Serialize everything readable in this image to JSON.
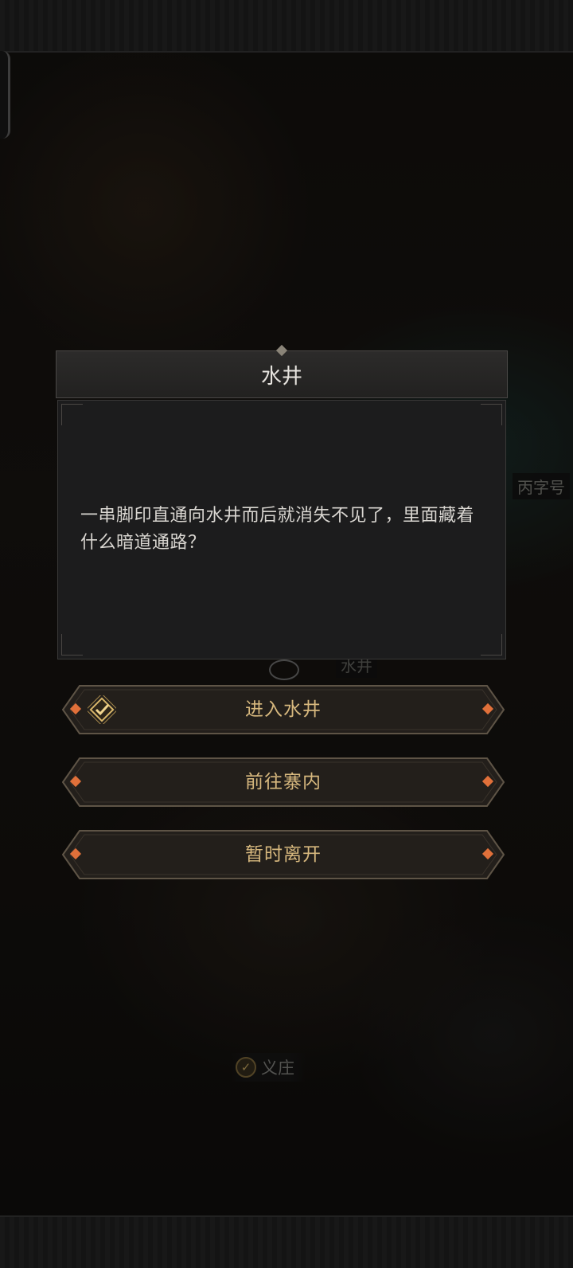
{
  "background": {
    "location_label_right": "丙字号",
    "location_label_well": "水井",
    "map_marker": {
      "label": "义庄",
      "icon": "check-badge-icon"
    }
  },
  "dialog": {
    "title": "水井",
    "body": "一串脚印直通向水井而后就消失不见了，里面藏着什么暗道通路？"
  },
  "choices": [
    {
      "label": "进入水井",
      "icon": "checked-diamond-icon",
      "selected": true
    },
    {
      "label": "前往寨内",
      "selected": false
    },
    {
      "label": "暂时离开",
      "selected": false
    }
  ],
  "colors": {
    "choice_text": "#d7b87e",
    "accent_gem": "#e0703a",
    "dialog_bg": "#1c1c1d"
  }
}
